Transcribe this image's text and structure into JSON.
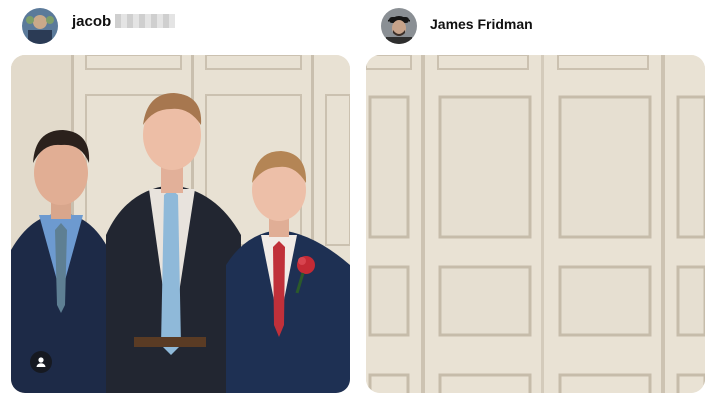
{
  "posts": {
    "left": {
      "username": "jacob",
      "avatar_icon": "profile-avatar",
      "tag_icon": "user-tag-icon"
    },
    "right": {
      "username": "James Fridman",
      "avatar_icon": "profile-avatar"
    }
  },
  "colors": {
    "door_panel": "#e8e1d3",
    "door_shadow": "#c9bfae",
    "suit_navy": "#1c2a45",
    "tie_blue": "#8fb9d9",
    "tie_red": "#c0303a"
  }
}
